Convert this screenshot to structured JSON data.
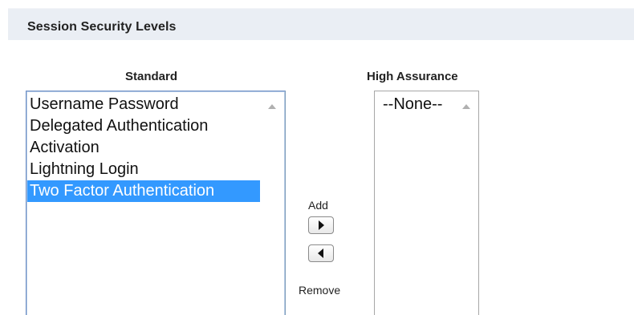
{
  "section": {
    "title": "Session Security Levels"
  },
  "standard": {
    "label": "Standard",
    "options": [
      "Username Password",
      "Delegated Authentication",
      "Activation",
      "Lightning Login",
      "Two Factor Authentication"
    ],
    "selected": "Two Factor Authentication"
  },
  "high_assurance": {
    "label": "High Assurance",
    "options": [
      "--None--"
    ]
  },
  "controls": {
    "add_label": "Add",
    "remove_label": "Remove",
    "add_icon": "right-arrow-icon",
    "remove_icon": "left-arrow-icon"
  },
  "colors": {
    "header_bg": "#eaeef4",
    "selection_bg": "#3399ff",
    "selection_text": "#ffffff"
  }
}
